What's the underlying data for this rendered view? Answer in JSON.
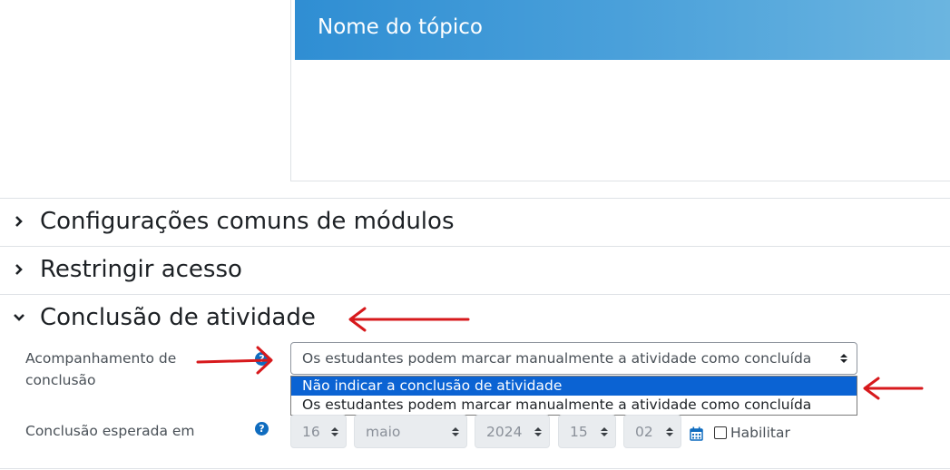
{
  "preview": {
    "title": "Nome do tópico"
  },
  "sections": {
    "common": {
      "title": "Configurações comuns de módulos"
    },
    "restrict": {
      "title": "Restringir acesso"
    },
    "completion": {
      "title": "Conclusão de atividade"
    }
  },
  "tracking": {
    "label_line1": "Acompanhamento de",
    "label_line2": "conclusão",
    "help": "?",
    "selected_value": "Os estudantes podem marcar manualmente a atividade como concluída",
    "options": [
      "Não indicar a conclusão de atividade",
      "Os estudantes podem marcar manualmente a atividade como concluída"
    ],
    "highlighted_option_index": 0
  },
  "expected": {
    "label": "Conclusão esperada em",
    "help": "?",
    "day": "16",
    "month": "maio",
    "year": "2024",
    "hour": "15",
    "minute": "02",
    "enable_label": "Habilitar",
    "enabled": false
  },
  "icons": {
    "chevron_right": "chevron-right-icon",
    "chevron_down": "chevron-down-icon",
    "help": "question-circle-icon",
    "calendar": "calendar-icon",
    "annotation_arrow": "red-arrow-annotation"
  },
  "colors": {
    "banner_start": "#2f8ed3",
    "banner_end": "#6bb5e0",
    "help_icon": "#0f6cbf",
    "option_highlight": "#0b63d3",
    "annotation": "#d7191c"
  }
}
